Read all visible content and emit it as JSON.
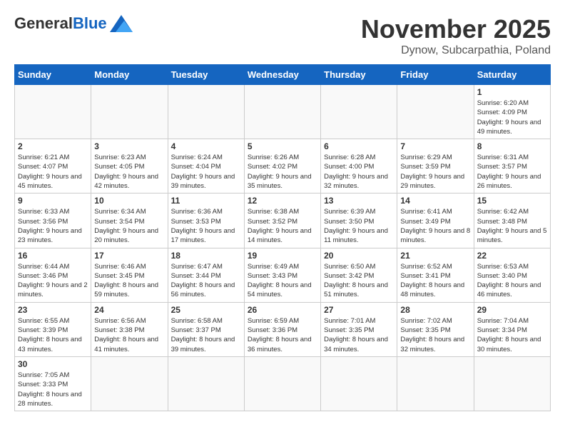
{
  "logo": {
    "general": "General",
    "blue": "Blue"
  },
  "title": {
    "month": "November 2025",
    "location": "Dynow, Subcarpathia, Poland"
  },
  "weekdays": [
    "Sunday",
    "Monday",
    "Tuesday",
    "Wednesday",
    "Thursday",
    "Friday",
    "Saturday"
  ],
  "weeks": [
    [
      {
        "day": "",
        "info": ""
      },
      {
        "day": "",
        "info": ""
      },
      {
        "day": "",
        "info": ""
      },
      {
        "day": "",
        "info": ""
      },
      {
        "day": "",
        "info": ""
      },
      {
        "day": "",
        "info": ""
      },
      {
        "day": "1",
        "info": "Sunrise: 6:20 AM\nSunset: 4:09 PM\nDaylight: 9 hours and 49 minutes."
      }
    ],
    [
      {
        "day": "2",
        "info": "Sunrise: 6:21 AM\nSunset: 4:07 PM\nDaylight: 9 hours and 45 minutes."
      },
      {
        "day": "3",
        "info": "Sunrise: 6:23 AM\nSunset: 4:05 PM\nDaylight: 9 hours and 42 minutes."
      },
      {
        "day": "4",
        "info": "Sunrise: 6:24 AM\nSunset: 4:04 PM\nDaylight: 9 hours and 39 minutes."
      },
      {
        "day": "5",
        "info": "Sunrise: 6:26 AM\nSunset: 4:02 PM\nDaylight: 9 hours and 35 minutes."
      },
      {
        "day": "6",
        "info": "Sunrise: 6:28 AM\nSunset: 4:00 PM\nDaylight: 9 hours and 32 minutes."
      },
      {
        "day": "7",
        "info": "Sunrise: 6:29 AM\nSunset: 3:59 PM\nDaylight: 9 hours and 29 minutes."
      },
      {
        "day": "8",
        "info": "Sunrise: 6:31 AM\nSunset: 3:57 PM\nDaylight: 9 hours and 26 minutes."
      }
    ],
    [
      {
        "day": "9",
        "info": "Sunrise: 6:33 AM\nSunset: 3:56 PM\nDaylight: 9 hours and 23 minutes."
      },
      {
        "day": "10",
        "info": "Sunrise: 6:34 AM\nSunset: 3:54 PM\nDaylight: 9 hours and 20 minutes."
      },
      {
        "day": "11",
        "info": "Sunrise: 6:36 AM\nSunset: 3:53 PM\nDaylight: 9 hours and 17 minutes."
      },
      {
        "day": "12",
        "info": "Sunrise: 6:38 AM\nSunset: 3:52 PM\nDaylight: 9 hours and 14 minutes."
      },
      {
        "day": "13",
        "info": "Sunrise: 6:39 AM\nSunset: 3:50 PM\nDaylight: 9 hours and 11 minutes."
      },
      {
        "day": "14",
        "info": "Sunrise: 6:41 AM\nSunset: 3:49 PM\nDaylight: 9 hours and 8 minutes."
      },
      {
        "day": "15",
        "info": "Sunrise: 6:42 AM\nSunset: 3:48 PM\nDaylight: 9 hours and 5 minutes."
      }
    ],
    [
      {
        "day": "16",
        "info": "Sunrise: 6:44 AM\nSunset: 3:46 PM\nDaylight: 9 hours and 2 minutes."
      },
      {
        "day": "17",
        "info": "Sunrise: 6:46 AM\nSunset: 3:45 PM\nDaylight: 8 hours and 59 minutes."
      },
      {
        "day": "18",
        "info": "Sunrise: 6:47 AM\nSunset: 3:44 PM\nDaylight: 8 hours and 56 minutes."
      },
      {
        "day": "19",
        "info": "Sunrise: 6:49 AM\nSunset: 3:43 PM\nDaylight: 8 hours and 54 minutes."
      },
      {
        "day": "20",
        "info": "Sunrise: 6:50 AM\nSunset: 3:42 PM\nDaylight: 8 hours and 51 minutes."
      },
      {
        "day": "21",
        "info": "Sunrise: 6:52 AM\nSunset: 3:41 PM\nDaylight: 8 hours and 48 minutes."
      },
      {
        "day": "22",
        "info": "Sunrise: 6:53 AM\nSunset: 3:40 PM\nDaylight: 8 hours and 46 minutes."
      }
    ],
    [
      {
        "day": "23",
        "info": "Sunrise: 6:55 AM\nSunset: 3:39 PM\nDaylight: 8 hours and 43 minutes."
      },
      {
        "day": "24",
        "info": "Sunrise: 6:56 AM\nSunset: 3:38 PM\nDaylight: 8 hours and 41 minutes."
      },
      {
        "day": "25",
        "info": "Sunrise: 6:58 AM\nSunset: 3:37 PM\nDaylight: 8 hours and 39 minutes."
      },
      {
        "day": "26",
        "info": "Sunrise: 6:59 AM\nSunset: 3:36 PM\nDaylight: 8 hours and 36 minutes."
      },
      {
        "day": "27",
        "info": "Sunrise: 7:01 AM\nSunset: 3:35 PM\nDaylight: 8 hours and 34 minutes."
      },
      {
        "day": "28",
        "info": "Sunrise: 7:02 AM\nSunset: 3:35 PM\nDaylight: 8 hours and 32 minutes."
      },
      {
        "day": "29",
        "info": "Sunrise: 7:04 AM\nSunset: 3:34 PM\nDaylight: 8 hours and 30 minutes."
      }
    ],
    [
      {
        "day": "30",
        "info": "Sunrise: 7:05 AM\nSunset: 3:33 PM\nDaylight: 8 hours and 28 minutes."
      },
      {
        "day": "",
        "info": ""
      },
      {
        "day": "",
        "info": ""
      },
      {
        "day": "",
        "info": ""
      },
      {
        "day": "",
        "info": ""
      },
      {
        "day": "",
        "info": ""
      },
      {
        "day": "",
        "info": ""
      }
    ]
  ]
}
